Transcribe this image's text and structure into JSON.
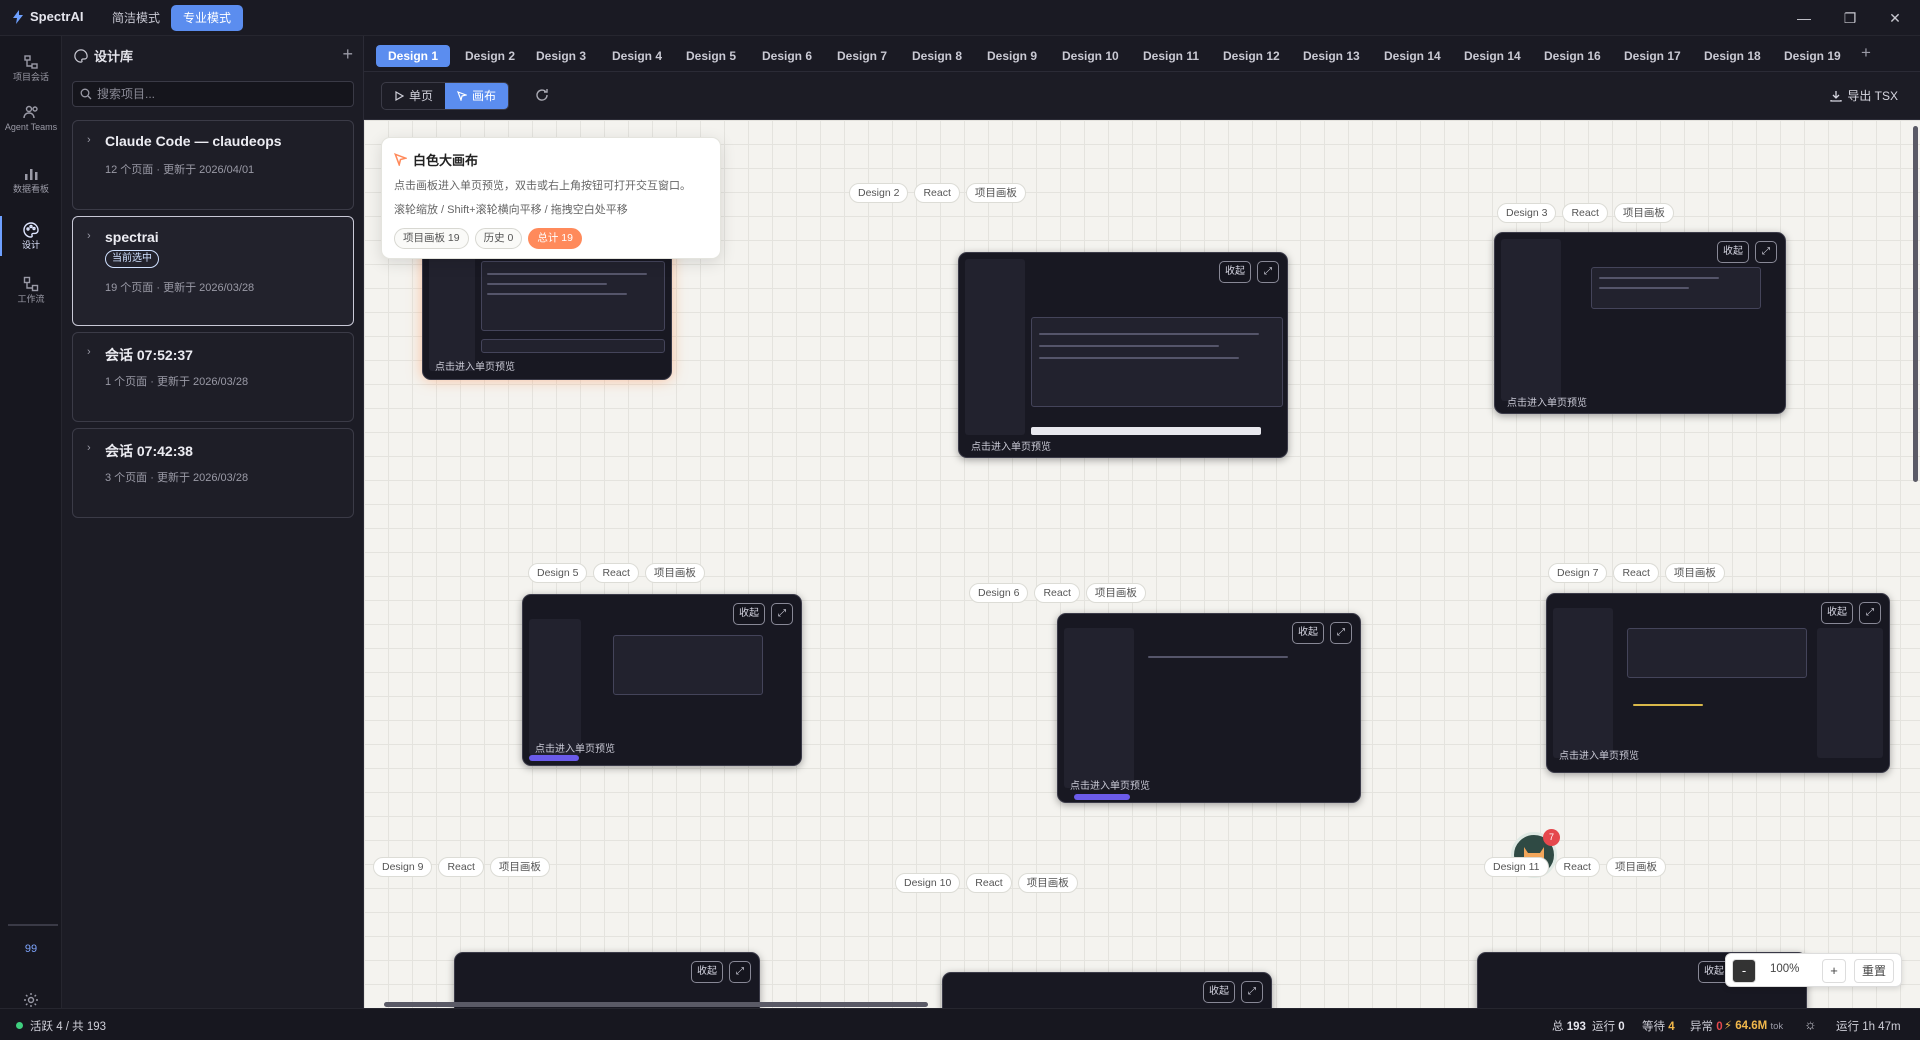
{
  "app": {
    "name": "SpectrAI"
  },
  "modes": [
    {
      "label": "简洁模式",
      "active": false
    },
    {
      "label": "专业模式",
      "active": true
    }
  ],
  "rail": {
    "items": [
      {
        "label": "项目会话",
        "icon": "project-session-icon"
      },
      {
        "label": "Agent Teams",
        "icon": "agent-teams-icon"
      },
      {
        "label": "数据看板",
        "icon": "dashboard-icon"
      },
      {
        "label": "设计",
        "icon": "palette-icon",
        "active": true
      },
      {
        "label": "工作流",
        "icon": "workflow-icon"
      }
    ],
    "counter": "99",
    "settings_label": "设置"
  },
  "library": {
    "title": "设计库",
    "search_placeholder": "搜索项目...",
    "projects": [
      {
        "name": "Claude Code — claudeops",
        "meta": "12 个页面 · 更新于 2026/04/01",
        "selected": false
      },
      {
        "name": "spectrai",
        "badge": "当前选中",
        "meta": "19 个页面 · 更新于 2026/03/28",
        "selected": true
      },
      {
        "name": "会话 07:52:37",
        "meta": "1 个页面 · 更新于 2026/03/28",
        "selected": false
      },
      {
        "name": "会话 07:42:38",
        "meta": "3 个页面 · 更新于 2026/03/28",
        "selected": false
      }
    ]
  },
  "tabs": [
    "Design 1",
    "Design 2",
    "Design 3",
    "Design 4",
    "Design 5",
    "Design 6",
    "Design 7",
    "Design 8",
    "Design 9",
    "Design 10",
    "Design 11",
    "Design 12",
    "Design 13",
    "Design 14",
    "Design 14",
    "Design 16",
    "Design 17",
    "Design 18",
    "Design 19"
  ],
  "toolbar": {
    "single_label": "单页",
    "canvas_label": "画布",
    "export_label": "导出 TSX"
  },
  "info": {
    "title": "白色大画布",
    "line1": "点击画板进入单页预览，双击或右上角按钮可打开交互窗口。",
    "line2": "滚轮缩放 / Shift+滚轮横向平移 / 拖拽空白处平移",
    "chip_boards": "项目画板 19",
    "chip_history": "历史 0",
    "chip_total": "总计 19"
  },
  "boards": [
    {
      "name": "Design 2",
      "tech": "React",
      "kind": "项目画板",
      "hint": "点击进入单页预览",
      "collapse": "收起"
    },
    {
      "name": "Design 3",
      "tech": "React",
      "kind": "项目画板",
      "hint": "点击进入单页预览",
      "collapse": "收起"
    },
    {
      "name": "Design 5",
      "tech": "React",
      "kind": "项目画板",
      "hint": "点击进入单页预览",
      "collapse": "收起"
    },
    {
      "name": "Design 6",
      "tech": "React",
      "kind": "项目画板",
      "hint": "点击进入单页预览",
      "collapse": "收起"
    },
    {
      "name": "Design 7",
      "tech": "React",
      "kind": "项目画板",
      "hint": "点击进入单页预览",
      "collapse": "收起"
    },
    {
      "name": "Design 9",
      "tech": "React",
      "kind": "项目画板",
      "collapse": "收起"
    },
    {
      "name": "Design 10",
      "tech": "React",
      "kind": "项目画板",
      "collapse": "收起"
    },
    {
      "name": "Design 11",
      "tech": "React",
      "kind": "项目画板",
      "collapse": "收起"
    }
  ],
  "board1_hint": "点击进入单页预览",
  "zoom": {
    "minus": "-",
    "value": "100%",
    "plus": "+",
    "reset": "重置"
  },
  "notification_count": "7",
  "status": {
    "active": "活跃 4 / 共 193",
    "total_label": "总",
    "total": "193",
    "running_label": "运行",
    "running": "0",
    "waiting_label": "等待",
    "waiting": "4",
    "error_label": "异常",
    "error": "0",
    "tokens": "64.6M",
    "tokens_unit": "tok",
    "uptime": "运行 1h 47m"
  },
  "colors": {
    "accent": "#5b8def",
    "hot": "#ff8a5b",
    "ok": "#3fcf7f",
    "error": "#e5484d"
  }
}
